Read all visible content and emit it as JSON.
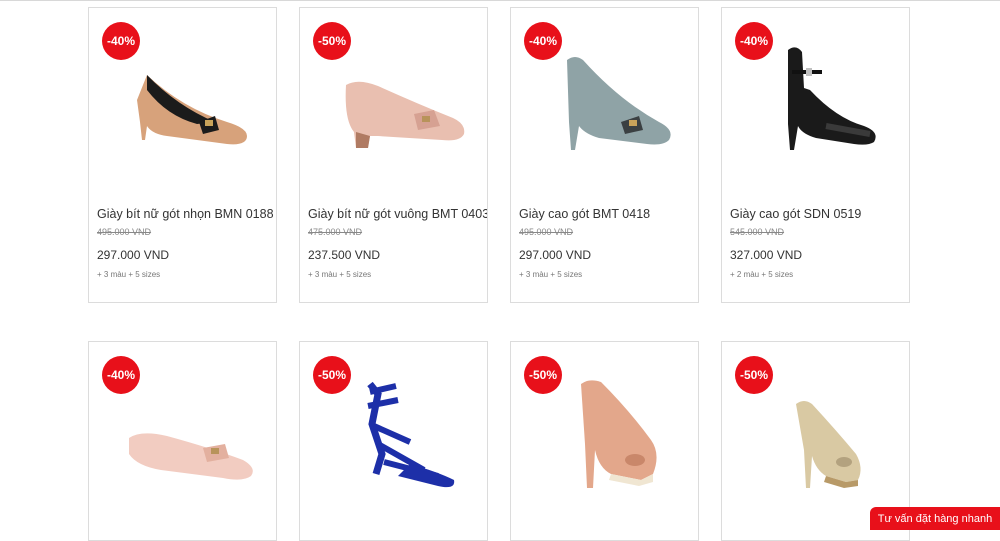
{
  "products": [
    {
      "discount": "-40%",
      "name": "Giày bít nữ gót nhọn BMN 0188",
      "old_price": "495.000 VND",
      "price": "297.000 VND",
      "variants": "+ 3 màu + 5 sizes"
    },
    {
      "discount": "-50%",
      "name": "Giày bít nữ gót vuông BMT 0403",
      "old_price": "475.000 VND",
      "price": "237.500 VND",
      "variants": "+ 3 màu + 5 sizes"
    },
    {
      "discount": "-40%",
      "name": "Giày cao gót BMT 0418",
      "old_price": "495.000 VND",
      "price": "297.000 VND",
      "variants": "+ 3 màu + 5 sizes"
    },
    {
      "discount": "-40%",
      "name": "Giày cao gót SDN 0519",
      "old_price": "545.000 VND",
      "price": "327.000 VND",
      "variants": "+ 2 màu + 5 sizes"
    },
    {
      "discount": "-40%"
    },
    {
      "discount": "-50%"
    },
    {
      "discount": "-50%"
    },
    {
      "discount": "-50%"
    }
  ],
  "cta": {
    "label": "Tư vấn đặt hàng nhanh"
  },
  "colors": {
    "badge": "#e8101a",
    "cta": "#e8101a"
  }
}
